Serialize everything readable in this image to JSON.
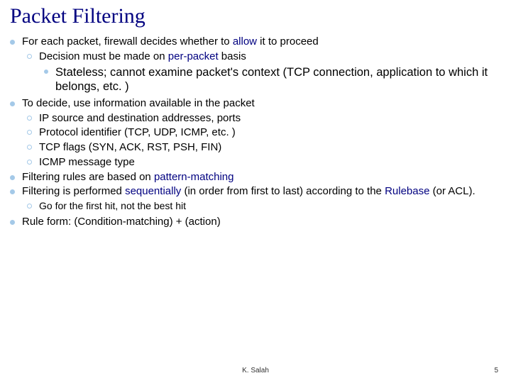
{
  "title": "Packet Filtering",
  "b1": {
    "text_a": "For each packet, firewall decides whether to ",
    "text_b": "allow",
    "text_c": " it to proceed",
    "s1_a": "Decision must be made on ",
    "s1_b": "per-packet",
    "s1_c": " basis",
    "ss1": "Stateless; cannot examine packet's context (TCP connection, application to which it belongs, etc. )"
  },
  "b2": {
    "text": "To decide, use information available in the packet",
    "s1": "IP source and destination addresses, ports",
    "s2": "Protocol identifier (TCP, UDP, ICMP, etc. )",
    "s3": "TCP flags (SYN, ACK, RST, PSH, FIN)",
    "s4": "ICMP message type"
  },
  "b3": {
    "text_a": "Filtering rules are based on ",
    "text_b": "pattern-matching"
  },
  "b4": {
    "text_a": "Filtering is performed ",
    "text_b": "sequentially",
    "text_c": " (in order from first to last) according to the ",
    "text_d": "Rulebase",
    "text_e": " (or ACL).",
    "s1": "Go for the first hit, not the best hit"
  },
  "b5": {
    "text": "Rule form: (Condition-matching) + (action)"
  },
  "footer": {
    "author": "K. Salah",
    "page": "5"
  }
}
